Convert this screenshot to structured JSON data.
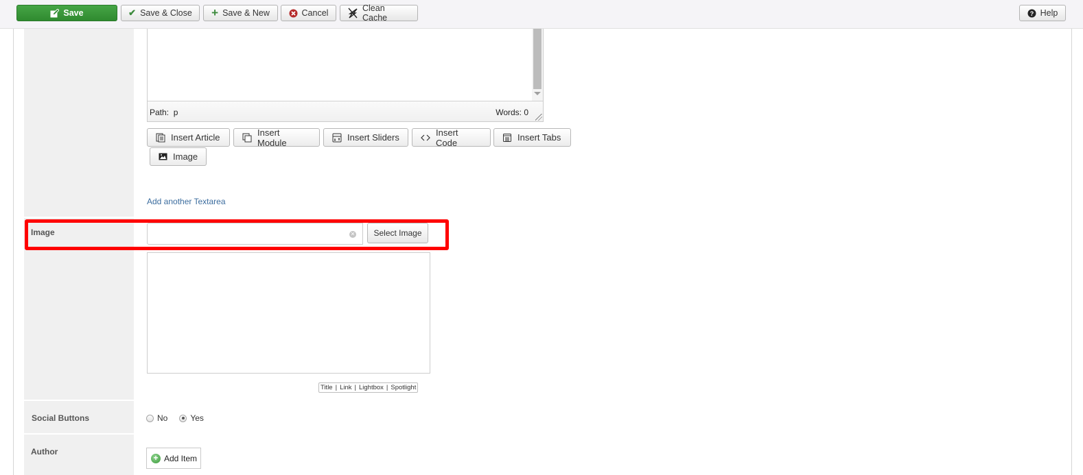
{
  "toolbar": {
    "save": "Save",
    "save_close": "Save & Close",
    "save_new": "Save & New",
    "cancel": "Cancel",
    "clean_cache": "Clean Cache",
    "help": "Help"
  },
  "editor": {
    "path_label": "Path:",
    "path_value": "p",
    "words": "Words: 0"
  },
  "insert_buttons": [
    {
      "label": "Insert Article",
      "icon": "article-icon"
    },
    {
      "label": "Insert Module",
      "icon": "module-icon"
    },
    {
      "label": "Insert Sliders",
      "icon": "sliders-icon"
    },
    {
      "label": "Insert Code",
      "icon": "code-icon"
    },
    {
      "label": "Insert Tabs",
      "icon": "tabs-icon"
    },
    {
      "label": "Image",
      "icon": "image-icon"
    }
  ],
  "add_textarea_link": "Add another Textarea",
  "image_field": {
    "label": "Image",
    "value": "",
    "select_button": "Select Image",
    "links": [
      "Title",
      "Link",
      "Lightbox",
      "Spotlight"
    ],
    "separator": "|"
  },
  "social_buttons": {
    "label": "Social Buttons",
    "options": [
      {
        "label": "No",
        "checked": false
      },
      {
        "label": "Yes",
        "checked": true
      }
    ]
  },
  "author": {
    "label": "Author",
    "add_button": "Add Item"
  },
  "colors": {
    "save_green": "#3c9a3c",
    "highlight_red": "#ff0000",
    "link_blue": "#3b6c9e",
    "label_bg": "#f0f0f0"
  }
}
